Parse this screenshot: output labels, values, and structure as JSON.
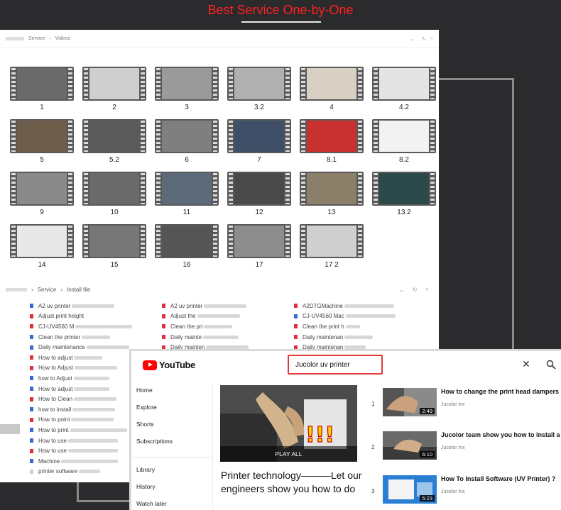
{
  "banner": {
    "title": "Best Service One-by-One"
  },
  "explorer_videos": {
    "breadcrumb": [
      "Service",
      "Videos"
    ],
    "tiles": [
      {
        "label": "1",
        "scene": "#6a6a6a"
      },
      {
        "label": "2",
        "scene": "#cfcfcf"
      },
      {
        "label": "3",
        "scene": "#9a9a9a"
      },
      {
        "label": "3.2",
        "scene": "#b0b0b0"
      },
      {
        "label": "4",
        "scene": "#d9d0c4"
      },
      {
        "label": "4.2",
        "scene": "#e4e4e4"
      },
      {
        "label": "5",
        "scene": "#6f5d4c"
      },
      {
        "label": "5.2",
        "scene": "#5a5a5a"
      },
      {
        "label": "6",
        "scene": "#7f7f7f"
      },
      {
        "label": "7",
        "scene": "#3f4f68"
      },
      {
        "label": "8.1",
        "scene": "#c93030"
      },
      {
        "label": "8.2",
        "scene": "#f2f2f2"
      },
      {
        "label": "9",
        "scene": "#8a8a8a"
      },
      {
        "label": "10",
        "scene": "#6a6a6a"
      },
      {
        "label": "11",
        "scene": "#5c6a7a"
      },
      {
        "label": "12",
        "scene": "#4a4a4a"
      },
      {
        "label": "13",
        "scene": "#8c7f6a"
      },
      {
        "label": "13.2",
        "scene": "#2d4a4a"
      },
      {
        "label": "14",
        "scene": "#e8e8e8"
      },
      {
        "label": "15",
        "scene": "#777777"
      },
      {
        "label": "16",
        "scene": "#555555"
      },
      {
        "label": "17",
        "scene": "#8d8d8d"
      },
      {
        "label": "17 2",
        "scene": "#cfcfcf"
      }
    ]
  },
  "explorer_files": {
    "breadcrumb": [
      "Service",
      "Install file"
    ],
    "columns": [
      [
        {
          "text": "A2 uv printer",
          "icon": "doc",
          "blur": 60
        },
        {
          "text": "Adjust print height",
          "icon": "pdf",
          "blur": 0
        },
        {
          "text": "CJ-UV4560 M",
          "icon": "pdf",
          "blur": 80
        },
        {
          "text": "Clean the printer",
          "icon": "doc",
          "blur": 40
        },
        {
          "text": "Daily maintenance",
          "icon": "doc",
          "blur": 60
        },
        {
          "text": "How to adjust",
          "icon": "pdf",
          "blur": 40
        },
        {
          "text": "How to Adjust",
          "icon": "pdf",
          "blur": 60
        },
        {
          "text": "how to Adjust",
          "icon": "doc",
          "blur": 50
        },
        {
          "text": "How to adjust",
          "icon": "doc",
          "blur": 50
        },
        {
          "text": "How to Clean",
          "icon": "pdf",
          "blur": 60
        },
        {
          "text": "how to install",
          "icon": "doc",
          "blur": 60
        },
        {
          "text": "How to point",
          "icon": "pdf",
          "blur": 60
        },
        {
          "text": "How to print",
          "icon": "doc",
          "blur": 80
        },
        {
          "text": "How to use",
          "icon": "doc",
          "blur": 70
        },
        {
          "text": "How to use",
          "icon": "pdf",
          "blur": 70
        },
        {
          "text": "Machine",
          "icon": "doc",
          "blur": 80
        },
        {
          "text": "printer software",
          "icon": "txt",
          "blur": 30
        }
      ],
      [
        {
          "text": "A2 uv printer",
          "icon": "pdf",
          "blur": 60
        },
        {
          "text": "Adjust the",
          "icon": "pdf",
          "blur": 60
        },
        {
          "text": "Clean the pri",
          "icon": "pdf",
          "blur": 40
        },
        {
          "text": "Daily mainte",
          "icon": "pdf",
          "blur": 50
        },
        {
          "text": "Daily mainten",
          "icon": "pdf",
          "blur": 60
        }
      ],
      [
        {
          "text": "A2DTGMachine",
          "icon": "pdf",
          "blur": 70
        },
        {
          "text": "CJ-UV4560 Mac",
          "icon": "doc",
          "blur": 70
        },
        {
          "text": "Clean the print h",
          "icon": "pdf",
          "blur": 20
        },
        {
          "text": "Daily maintenan",
          "icon": "pdf",
          "blur": 40
        },
        {
          "text": "Daily maintenan",
          "icon": "pdf",
          "blur": 30
        }
      ]
    ]
  },
  "youtube": {
    "logo_text": "YouTube",
    "search_value": "Jucolor uv printer",
    "sidebar": [
      "Home",
      "Explore",
      "Shorts",
      "Subscriptions",
      "Library",
      "History",
      "Watch later"
    ],
    "playlist": {
      "play_all": "PLAY ALL",
      "title": "Printer technology———Let our engineers show you how to do"
    },
    "videos": [
      {
        "index": "1",
        "title": "How to change the print head dampers",
        "channel": "Jucolor lnx",
        "duration": "2:49"
      },
      {
        "index": "2",
        "title": "Jucolor team show you how to install a",
        "channel": "Jucolor lnx",
        "duration": "6:10"
      },
      {
        "index": "3",
        "title": "How To Install Software (UV Printer) ?",
        "channel": "Jucolor lnx",
        "duration": "5:23"
      }
    ]
  }
}
